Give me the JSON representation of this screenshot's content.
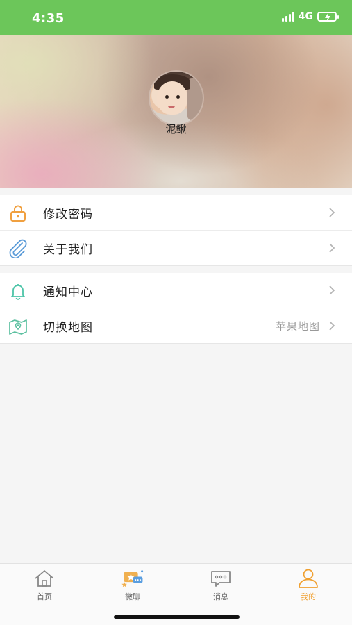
{
  "status_bar": {
    "time": "4:35",
    "network": "4G"
  },
  "profile": {
    "name": "泥鳅"
  },
  "menu_group_1": [
    {
      "label": "修改密码",
      "icon": "lock-icon"
    },
    {
      "label": "关于我们",
      "icon": "paperclip-icon"
    }
  ],
  "menu_group_2": [
    {
      "label": "通知中心",
      "icon": "bell-icon"
    },
    {
      "label": "切换地图",
      "icon": "map-icon",
      "value": "苹果地图"
    }
  ],
  "tab_bar": {
    "items": [
      {
        "label": "首页",
        "icon": "home-icon"
      },
      {
        "label": "微聊",
        "icon": "chat-star-icon"
      },
      {
        "label": "消息",
        "icon": "message-icon"
      },
      {
        "label": "我的",
        "icon": "person-icon",
        "active": true
      }
    ]
  },
  "colors": {
    "status_bar": "#6cc65a",
    "accent": "#f0a030",
    "lock_icon": "#f0a040",
    "paperclip_icon": "#5b9bd8",
    "bell_icon": "#4cc4a8",
    "map_icon": "#5cc0a0"
  }
}
